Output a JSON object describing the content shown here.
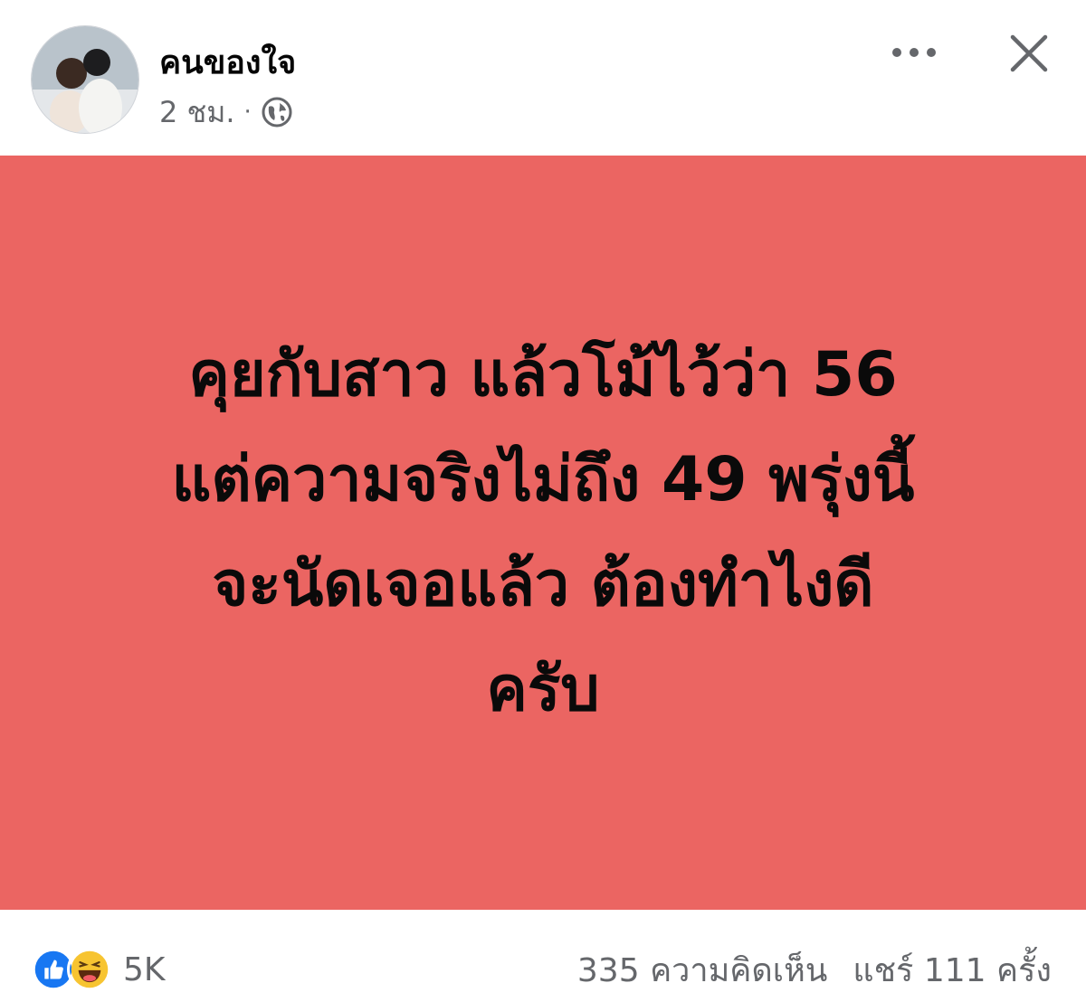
{
  "post": {
    "author_name": "คนของใจ",
    "timestamp": "2 ชม.",
    "separator": "·",
    "privacy_icon": "globe-icon",
    "avatar": "profile-photo-couple",
    "menu_icon": "more-horizontal-icon",
    "close_icon": "close-icon",
    "background_color": "#eb6562",
    "text_lines": [
      "คุยกับสาว แล้วโม้ไว้ว่า 56",
      "แต่ความจริงไม่ถึง 49 พรุ่งนี้",
      "จะนัดเจอแล้ว ต้องทำไงดี",
      "ครับ"
    ]
  },
  "footer": {
    "reaction_icons": [
      "like-icon",
      "haha-icon"
    ],
    "reaction_count": "5K",
    "comments": "335 ความคิดเห็น",
    "shares": "แชร์ 111 ครั้ง"
  }
}
